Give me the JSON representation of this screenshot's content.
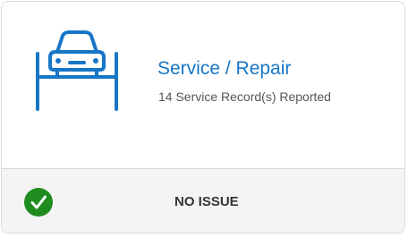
{
  "card": {
    "title": "Service / Repair",
    "subtitle": "14 Service Record(s) Reported",
    "icon": "car-on-lift-icon",
    "accent_color": "#1776c6"
  },
  "status": {
    "label": "NO ISSUE",
    "icon": "check-circle-icon",
    "color": "#1f8c20"
  }
}
